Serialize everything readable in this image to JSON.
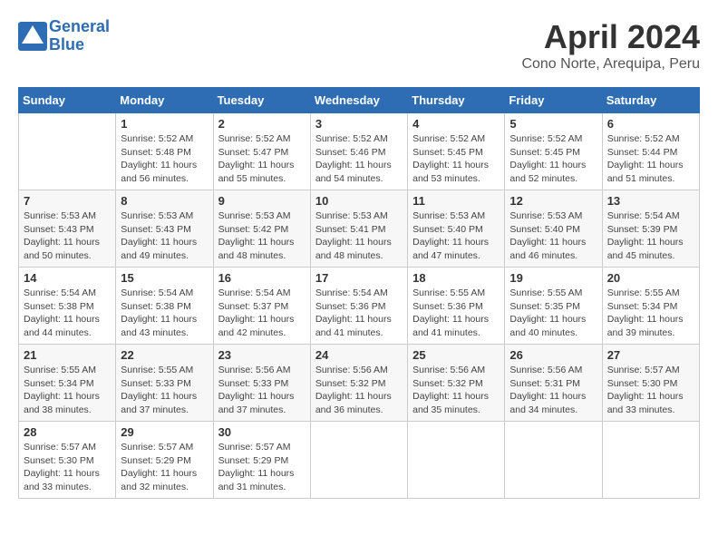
{
  "header": {
    "logo_line1": "General",
    "logo_line2": "Blue",
    "month_title": "April 2024",
    "location": "Cono Norte, Arequipa, Peru"
  },
  "days_of_week": [
    "Sunday",
    "Monday",
    "Tuesday",
    "Wednesday",
    "Thursday",
    "Friday",
    "Saturday"
  ],
  "weeks": [
    [
      {
        "day": "",
        "info": ""
      },
      {
        "day": "1",
        "info": "Sunrise: 5:52 AM\nSunset: 5:48 PM\nDaylight: 11 hours\nand 56 minutes."
      },
      {
        "day": "2",
        "info": "Sunrise: 5:52 AM\nSunset: 5:47 PM\nDaylight: 11 hours\nand 55 minutes."
      },
      {
        "day": "3",
        "info": "Sunrise: 5:52 AM\nSunset: 5:46 PM\nDaylight: 11 hours\nand 54 minutes."
      },
      {
        "day": "4",
        "info": "Sunrise: 5:52 AM\nSunset: 5:45 PM\nDaylight: 11 hours\nand 53 minutes."
      },
      {
        "day": "5",
        "info": "Sunrise: 5:52 AM\nSunset: 5:45 PM\nDaylight: 11 hours\nand 52 minutes."
      },
      {
        "day": "6",
        "info": "Sunrise: 5:52 AM\nSunset: 5:44 PM\nDaylight: 11 hours\nand 51 minutes."
      }
    ],
    [
      {
        "day": "7",
        "info": "Sunrise: 5:53 AM\nSunset: 5:43 PM\nDaylight: 11 hours\nand 50 minutes."
      },
      {
        "day": "8",
        "info": "Sunrise: 5:53 AM\nSunset: 5:43 PM\nDaylight: 11 hours\nand 49 minutes."
      },
      {
        "day": "9",
        "info": "Sunrise: 5:53 AM\nSunset: 5:42 PM\nDaylight: 11 hours\nand 48 minutes."
      },
      {
        "day": "10",
        "info": "Sunrise: 5:53 AM\nSunset: 5:41 PM\nDaylight: 11 hours\nand 48 minutes."
      },
      {
        "day": "11",
        "info": "Sunrise: 5:53 AM\nSunset: 5:40 PM\nDaylight: 11 hours\nand 47 minutes."
      },
      {
        "day": "12",
        "info": "Sunrise: 5:53 AM\nSunset: 5:40 PM\nDaylight: 11 hours\nand 46 minutes."
      },
      {
        "day": "13",
        "info": "Sunrise: 5:54 AM\nSunset: 5:39 PM\nDaylight: 11 hours\nand 45 minutes."
      }
    ],
    [
      {
        "day": "14",
        "info": "Sunrise: 5:54 AM\nSunset: 5:38 PM\nDaylight: 11 hours\nand 44 minutes."
      },
      {
        "day": "15",
        "info": "Sunrise: 5:54 AM\nSunset: 5:38 PM\nDaylight: 11 hours\nand 43 minutes."
      },
      {
        "day": "16",
        "info": "Sunrise: 5:54 AM\nSunset: 5:37 PM\nDaylight: 11 hours\nand 42 minutes."
      },
      {
        "day": "17",
        "info": "Sunrise: 5:54 AM\nSunset: 5:36 PM\nDaylight: 11 hours\nand 41 minutes."
      },
      {
        "day": "18",
        "info": "Sunrise: 5:55 AM\nSunset: 5:36 PM\nDaylight: 11 hours\nand 41 minutes."
      },
      {
        "day": "19",
        "info": "Sunrise: 5:55 AM\nSunset: 5:35 PM\nDaylight: 11 hours\nand 40 minutes."
      },
      {
        "day": "20",
        "info": "Sunrise: 5:55 AM\nSunset: 5:34 PM\nDaylight: 11 hours\nand 39 minutes."
      }
    ],
    [
      {
        "day": "21",
        "info": "Sunrise: 5:55 AM\nSunset: 5:34 PM\nDaylight: 11 hours\nand 38 minutes."
      },
      {
        "day": "22",
        "info": "Sunrise: 5:55 AM\nSunset: 5:33 PM\nDaylight: 11 hours\nand 37 minutes."
      },
      {
        "day": "23",
        "info": "Sunrise: 5:56 AM\nSunset: 5:33 PM\nDaylight: 11 hours\nand 37 minutes."
      },
      {
        "day": "24",
        "info": "Sunrise: 5:56 AM\nSunset: 5:32 PM\nDaylight: 11 hours\nand 36 minutes."
      },
      {
        "day": "25",
        "info": "Sunrise: 5:56 AM\nSunset: 5:32 PM\nDaylight: 11 hours\nand 35 minutes."
      },
      {
        "day": "26",
        "info": "Sunrise: 5:56 AM\nSunset: 5:31 PM\nDaylight: 11 hours\nand 34 minutes."
      },
      {
        "day": "27",
        "info": "Sunrise: 5:57 AM\nSunset: 5:30 PM\nDaylight: 11 hours\nand 33 minutes."
      }
    ],
    [
      {
        "day": "28",
        "info": "Sunrise: 5:57 AM\nSunset: 5:30 PM\nDaylight: 11 hours\nand 33 minutes."
      },
      {
        "day": "29",
        "info": "Sunrise: 5:57 AM\nSunset: 5:29 PM\nDaylight: 11 hours\nand 32 minutes."
      },
      {
        "day": "30",
        "info": "Sunrise: 5:57 AM\nSunset: 5:29 PM\nDaylight: 11 hours\nand 31 minutes."
      },
      {
        "day": "",
        "info": ""
      },
      {
        "day": "",
        "info": ""
      },
      {
        "day": "",
        "info": ""
      },
      {
        "day": "",
        "info": ""
      }
    ]
  ]
}
